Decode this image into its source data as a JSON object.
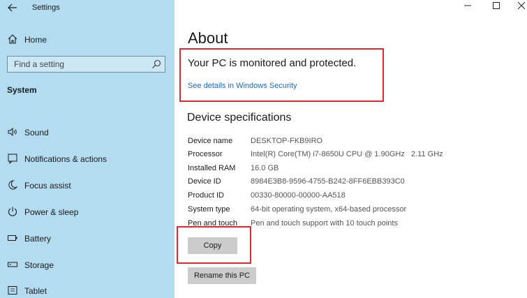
{
  "window": {
    "title": "Settings",
    "back_icon": "arrow-left-icon",
    "controls": [
      "minimize",
      "maximize",
      "close"
    ]
  },
  "sidebar": {
    "home_label": "Home",
    "search_placeholder": "Find a setting",
    "section_title": "System",
    "items": [
      {
        "label": "Sound",
        "icon": "speaker-icon"
      },
      {
        "label": "Notifications & actions",
        "icon": "notification-icon"
      },
      {
        "label": "Focus assist",
        "icon": "moon-icon"
      },
      {
        "label": "Power & sleep",
        "icon": "power-icon"
      },
      {
        "label": "Battery",
        "icon": "battery-icon"
      },
      {
        "label": "Storage",
        "icon": "storage-icon"
      },
      {
        "label": "Tablet",
        "icon": "tablet-icon"
      }
    ]
  },
  "main": {
    "title": "About",
    "protection_text": "Your PC is monitored and protected.",
    "security_link": "See details in Windows Security",
    "spec_heading": "Device specifications",
    "specs": [
      {
        "label": "Device name",
        "value": "DESKTOP-FKB9IRO"
      },
      {
        "label": "Processor",
        "value": "Intel(R) Core(TM) i7-8650U CPU @ 1.90GHz   2.11 GHz"
      },
      {
        "label": "Installed RAM",
        "value": "16.0 GB"
      },
      {
        "label": "Device ID",
        "value": "8984E3B8-9596-4755-B242-8FF6EBB393C0"
      },
      {
        "label": "Product ID",
        "value": "00330-80000-00000-AA518"
      },
      {
        "label": "System type",
        "value": "64-bit operating system, x64-based processor"
      },
      {
        "label": "Pen and touch",
        "value": "Pen and touch support with 10 touch points"
      }
    ],
    "copy_label": "Copy",
    "rename_label": "Rename this PC"
  },
  "colors": {
    "sidebar_bg": "#b4dcf0",
    "highlight_red": "#e0282e",
    "link_blue": "#1a6bc0",
    "button_gray": "#cccccc"
  }
}
